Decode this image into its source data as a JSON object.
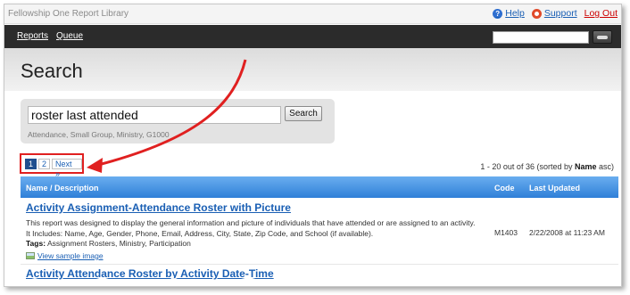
{
  "app": {
    "title": "Fellowship One Report Library"
  },
  "toplinks": {
    "help": "Help",
    "support": "Support",
    "logout": "Log Out"
  },
  "nav": {
    "reports": "Reports",
    "queue": "Queue",
    "search_value": ""
  },
  "page": {
    "title": "Search"
  },
  "search": {
    "query": "roster last attended",
    "button": "Search",
    "hint": "Attendance, Small Group, Ministry, G1000"
  },
  "pager": {
    "pages": [
      "1",
      "2"
    ],
    "current": "1",
    "next": "Next »"
  },
  "results": {
    "count_prefix": "1 - 20 out of 36 (sorted by ",
    "sort_field": "Name",
    "count_suffix": " asc)"
  },
  "table": {
    "headers": {
      "name": "Name / Description",
      "code": "Code",
      "updated": "Last Updated"
    },
    "rows": [
      {
        "title": "Activity Assignment-Attendance Roster with Picture",
        "desc1": "This report was designed to display the general information and picture of individuals that have attended or are assigned to an activity.",
        "desc2": "It Includes: Name, Age, Gender, Phone, Email, Address, City, State, Zip Code, and School (if available).",
        "tags_label": "Tags:",
        "tags": " Assignment Rosters, Ministry, Participation",
        "sample": "View sample image",
        "code": "M1403",
        "updated": "2/22/2008 at 11:23 AM"
      },
      {
        "title": "Activity Attendance Roster by Activity Date-Time"
      }
    ]
  },
  "colors": {
    "nav_bg": "#2b2b2b",
    "header_blue": "#2f7fd8",
    "link": "#1a5fb4",
    "annotation_red": "#e02020",
    "logout": "#cc0000"
  }
}
